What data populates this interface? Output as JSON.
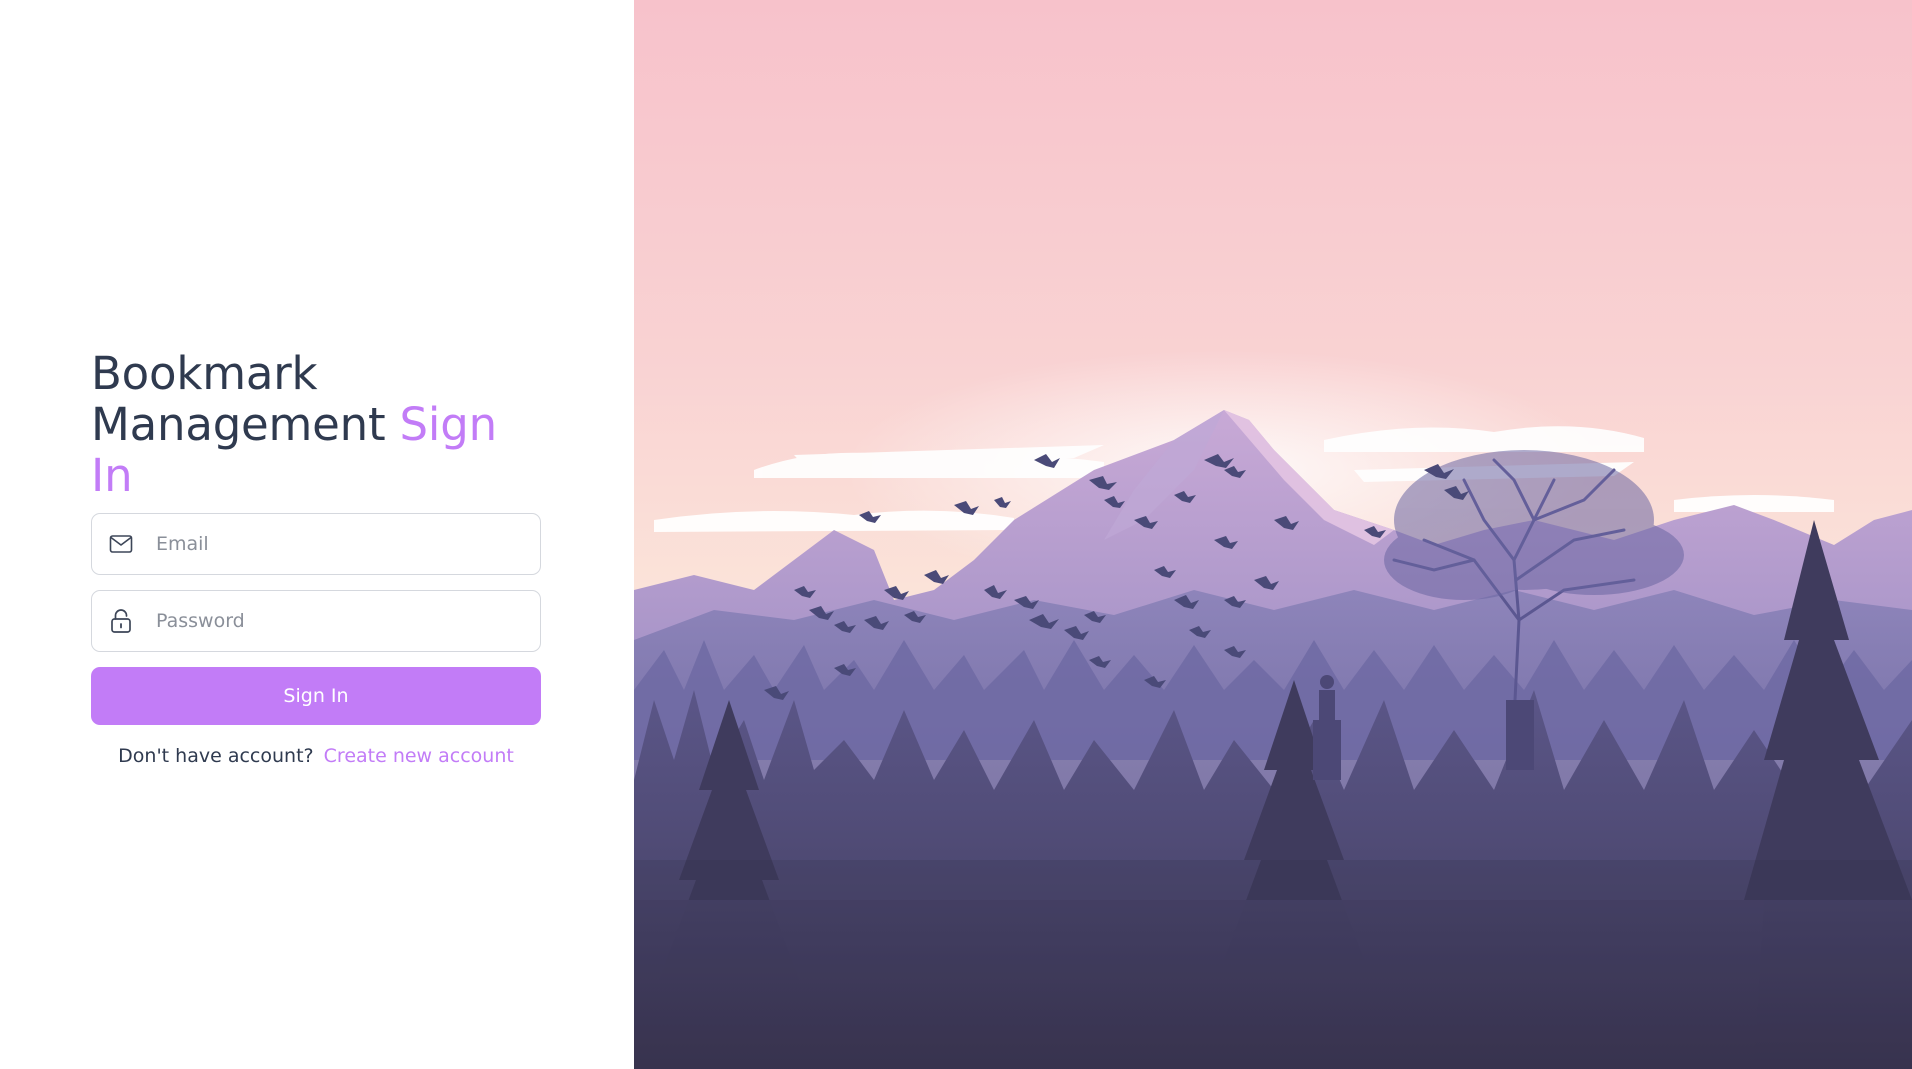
{
  "title": {
    "line1": "Bookmark",
    "line2": "Management",
    "accent": "Sign In"
  },
  "email": {
    "placeholder": "Email",
    "value": "",
    "icon": "mail-icon"
  },
  "password": {
    "placeholder": "Password",
    "value": "",
    "icon": "lock-icon"
  },
  "signin_button": {
    "label": "Sign In"
  },
  "footer": {
    "prompt": "Don't have account?",
    "link_label": "Create new account"
  },
  "colors": {
    "accent": "#c27cf7",
    "text_dark": "#2f3a4f",
    "border": "#d5d8de",
    "sky_top": "#f7c4cc",
    "sky_bottom": "#fbe0d8",
    "mountain": "#a99bc9",
    "forest_dark": "#44405f"
  }
}
